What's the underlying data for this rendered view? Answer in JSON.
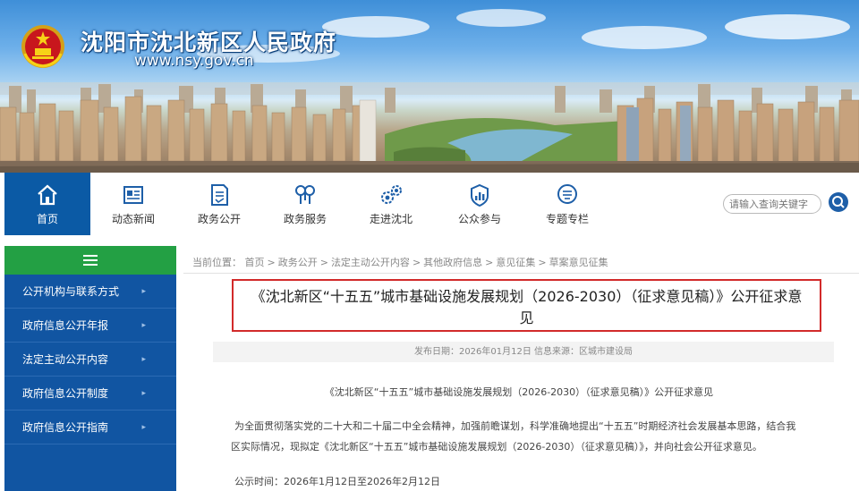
{
  "header": {
    "site_title": "沈阳市沈北新区人民政府",
    "site_url": "www.nsy.gov.cn"
  },
  "nav": {
    "items": [
      {
        "label": "首页",
        "icon": "home-icon",
        "active": true
      },
      {
        "label": "动态新闻",
        "icon": "news-icon",
        "active": false
      },
      {
        "label": "政务公开",
        "icon": "document-icon",
        "active": false
      },
      {
        "label": "政务服务",
        "icon": "service-icon",
        "active": false
      },
      {
        "label": "走进沈北",
        "icon": "gears-icon",
        "active": false
      },
      {
        "label": "公众参与",
        "icon": "chart-shield-icon",
        "active": false
      },
      {
        "label": "专题专栏",
        "icon": "column-icon",
        "active": false
      }
    ],
    "search_placeholder": "请输入查询关键字",
    "active_color": "#0b5aa5"
  },
  "sidebar": {
    "header_icon": "menu-icon",
    "header_color": "#23a044",
    "background_color": "#1155a2",
    "items": [
      {
        "label": "公开机构与联系方式"
      },
      {
        "label": "政府信息公开年报"
      },
      {
        "label": "法定主动公开内容"
      },
      {
        "label": "政府信息公开制度"
      },
      {
        "label": "政府信息公开指南"
      }
    ]
  },
  "breadcrumb": {
    "prefix": "当前位置：",
    "items": [
      "首页",
      "政务公开",
      "法定主动公开内容",
      "其他政府信息",
      "意见征集",
      "草案意见征集"
    ],
    "separator": ">"
  },
  "article": {
    "title": "《沈北新区“十五五”城市基础设施发展规划（2026-2030）（征求意见稿）》公开征求意见",
    "highlight_color": "#d22a2a",
    "meta": "发布日期：2026年01月12日 信息来源：区城市建设局",
    "doc_title": "《沈北新区“十五五”城市基础设施发展规划（2026-2030）（征求意见稿）》公开征求意见",
    "para_line1": "为全面贯彻落实党的二十大和二十届二中全会精神，加强前瞻谋划，科学准确地提出“十五五”时期经济社会发展基本思路，结合我",
    "para_line2": "区实际情况，现拟定《沈北新区“十五五”城市基础设施发展规划（2026-2030）（征求意见稿）》，并向社会公开征求意见。",
    "pub_time": "公示时间：2026年1月12日至2026年2月12日"
  }
}
